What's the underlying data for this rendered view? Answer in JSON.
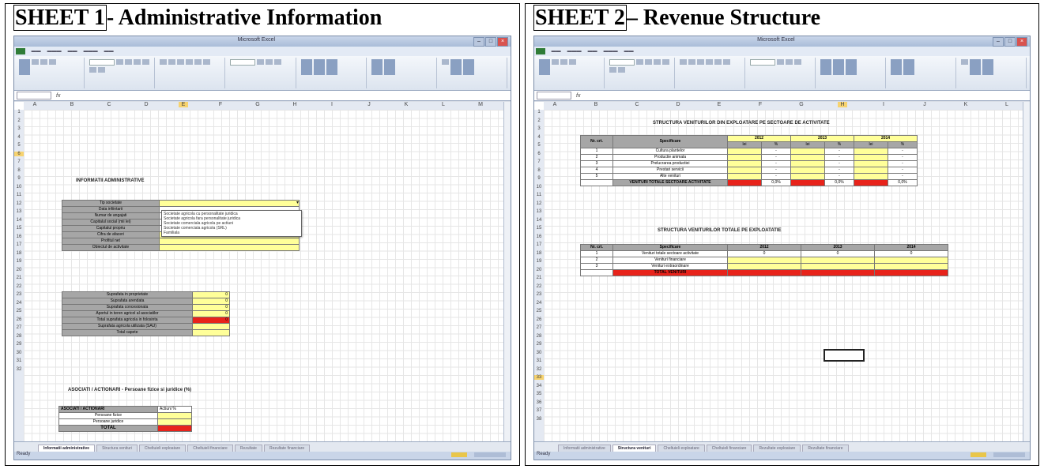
{
  "sheet1": {
    "title_boxed": "SHEET 1",
    "title_rest": "- Administrative Information",
    "window_title": "Microsoft Excel",
    "column_headers": [
      "A",
      "B",
      "C",
      "D",
      "E",
      "F",
      "G",
      "H",
      "I",
      "J",
      "K",
      "L",
      "M"
    ],
    "rows": [
      "1",
      "2",
      "3",
      "4",
      "5",
      "6",
      "7",
      "8",
      "9",
      "10",
      "11",
      "12",
      "13",
      "14",
      "15",
      "16",
      "17",
      "18",
      "19",
      "20",
      "21",
      "22",
      "23",
      "24",
      "25",
      "26",
      "27",
      "28",
      "29",
      "30",
      "31",
      "32"
    ],
    "heading": "INFORMATII ADMINISTRATIVE",
    "admin_labels": [
      "Tip societate",
      "Data infiintarii",
      "Numar de angajati",
      "Capitalul social (mii lei)",
      "Capitalul propriu",
      "Cifra de afaceri",
      "Profitul net",
      "Obiectul de activitate"
    ],
    "dropdown_options": [
      "Societate agricola cu personalitate juridica",
      "Societate agricola fara personalitate juridica",
      "Societate comerciala agricola pe actiuni",
      "Societate comerciala agricola (SRL)",
      "Familiala"
    ],
    "land_labels": [
      "Suprafata in proprietate",
      "Suprafata arendata",
      "Suprafata concesionata",
      "Aportul in teren agricol al asociatilor",
      "Total suprafata agricola in folosinta",
      "Suprafata agricola utilizata (SAU)",
      "Total capete"
    ],
    "land_values": [
      "0",
      "0",
      "0",
      "0",
      "0",
      "",
      ""
    ],
    "assoc_heading": "ASOCIATI / ACTIONARI - Persoane fizice si juridice (%)",
    "assoc_header": [
      "ASOCIATI / ACTIONARI",
      "Actiuni %"
    ],
    "assoc_rows": [
      "Persoane fizice",
      "Persoane juridice"
    ],
    "assoc_total": "TOTAL",
    "tabs": [
      "Informatii administrative",
      "Structura venituri",
      "Cheltuieli exploatare",
      "Cheltuieli financiare",
      "Rezultate",
      "Rezultate financiare"
    ],
    "status": "Ready"
  },
  "sheet2": {
    "title_boxed": "SHEET 2",
    "title_rest": "– Revenue Structure",
    "window_title": "Microsoft Excel",
    "column_headers": [
      "A",
      "B",
      "C",
      "D",
      "E",
      "F",
      "G",
      "H",
      "I",
      "J",
      "K",
      "L"
    ],
    "rows": [
      "1",
      "2",
      "3",
      "4",
      "5",
      "6",
      "7",
      "8",
      "9",
      "10",
      "11",
      "12",
      "13",
      "14",
      "15",
      "16",
      "17",
      "18",
      "19",
      "20",
      "21",
      "22",
      "23",
      "24",
      "25",
      "26",
      "27",
      "28",
      "29",
      "30",
      "31",
      "32",
      "33",
      "34",
      "35",
      "36",
      "37",
      "38"
    ],
    "table1_title": "STRUCTURA VENITURILOR DIN EXPLOATARE PE SECTOARE DE ACTIVITATE",
    "table1_headers": {
      "nr": "Nr. crt.",
      "spec": "Specificare",
      "years": [
        "2012",
        "2013",
        "2014"
      ],
      "sub": [
        "lei",
        "%"
      ]
    },
    "table1_rows": [
      {
        "nr": "1",
        "spec": "Cultura plantelor"
      },
      {
        "nr": "2",
        "spec": "Productie animala"
      },
      {
        "nr": "3",
        "spec": "Prelucrarea productiei"
      },
      {
        "nr": "4",
        "spec": "Prestari servicii"
      },
      {
        "nr": "5",
        "spec": "Alte venituri"
      }
    ],
    "table1_dash": "-",
    "table1_total_label": "VENITURI TOTALE SECTOARE ACTIVITATE",
    "table1_total_pct": "0,0%",
    "table2_title": "STRUCTURA VENITURILOR TOTALE PE EXPLOATATIE",
    "table2_headers": [
      "Nr. crt.",
      "Specificare",
      "2012",
      "2013",
      "2014"
    ],
    "table2_rows": [
      {
        "nr": "1",
        "spec": "Venituri totale sectoare activitate",
        "vals": [
          "0",
          "0",
          "0"
        ]
      },
      {
        "nr": "2",
        "spec": "Venituri financiare",
        "vals": [
          "",
          "",
          ""
        ]
      },
      {
        "nr": "3",
        "spec": "Venituri extraordinare",
        "vals": [
          "",
          "",
          ""
        ]
      }
    ],
    "table2_total_label": "TOTAL VENITURI",
    "tabs": [
      "Informatii administrative",
      "Structura venituri",
      "Cheltuieli exploatare",
      "Cheltuieli financiare",
      "Rezultate exploatare",
      "Rezultate financiare"
    ],
    "status": "Ready"
  }
}
